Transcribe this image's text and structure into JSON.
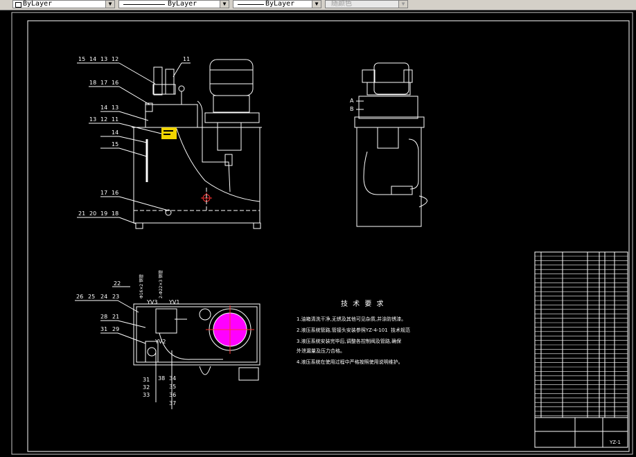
{
  "toolbar": {
    "layer_combo": "ByLayer",
    "linetype_combo": "ByLayer",
    "lineweight_combo": "ByLayer",
    "color_combo": "随颜色"
  },
  "drawing": {
    "front_view_labels": {
      "r1": [
        "15",
        "14",
        "13",
        "12"
      ],
      "r1b": "11",
      "r2": [
        "18",
        "17",
        "16"
      ],
      "r3": [
        "14",
        "13"
      ],
      "r4": [
        "13",
        "12",
        "11"
      ],
      "r5": "14",
      "r6": "15",
      "r7": [
        "17",
        "16"
      ],
      "r8": [
        "21",
        "20",
        "19",
        "18"
      ]
    },
    "side_view_labels": {
      "a": "A",
      "b": "B"
    },
    "top_view_labels": {
      "left": [
        "26",
        "25",
        "24",
        "23"
      ],
      "l22": "22",
      "l21": [
        "28",
        "21"
      ],
      "l29": [
        "31",
        "29"
      ],
      "yv3": "YV3",
      "yv1": "YV1",
      "yv2": "YV2",
      "bottom1": [
        "31",
        "32",
        "33"
      ],
      "bottom2": [
        "38",
        "34",
        "35",
        "36",
        "37"
      ],
      "vert1": "Φ16×2 钢管",
      "vert2": "2-Φ22×3 钢管"
    },
    "tech": {
      "title": "技 术 要 求",
      "lines": [
        "1.油箱清洗干净,无锈及其他可见杂质,并涂防锈漆。",
        "2.液压系统管路,管接头安装参照YZ-4-101",
        "3.液压系统安装完毕后,调整各控制阀及管路,确保",
        "   外泄漏量及压力合格。",
        "4.液压系统在使用过程中严格按照使用说明维护。"
      ],
      "note": "技术规范"
    },
    "title_block": {
      "drawing_no": "YZ-1"
    }
  },
  "colors": {
    "background": "#000000",
    "line": "#ffffff",
    "highlight_yellow": "#f2d500",
    "magenta": "#ff00ff",
    "red": "#ff3030"
  }
}
